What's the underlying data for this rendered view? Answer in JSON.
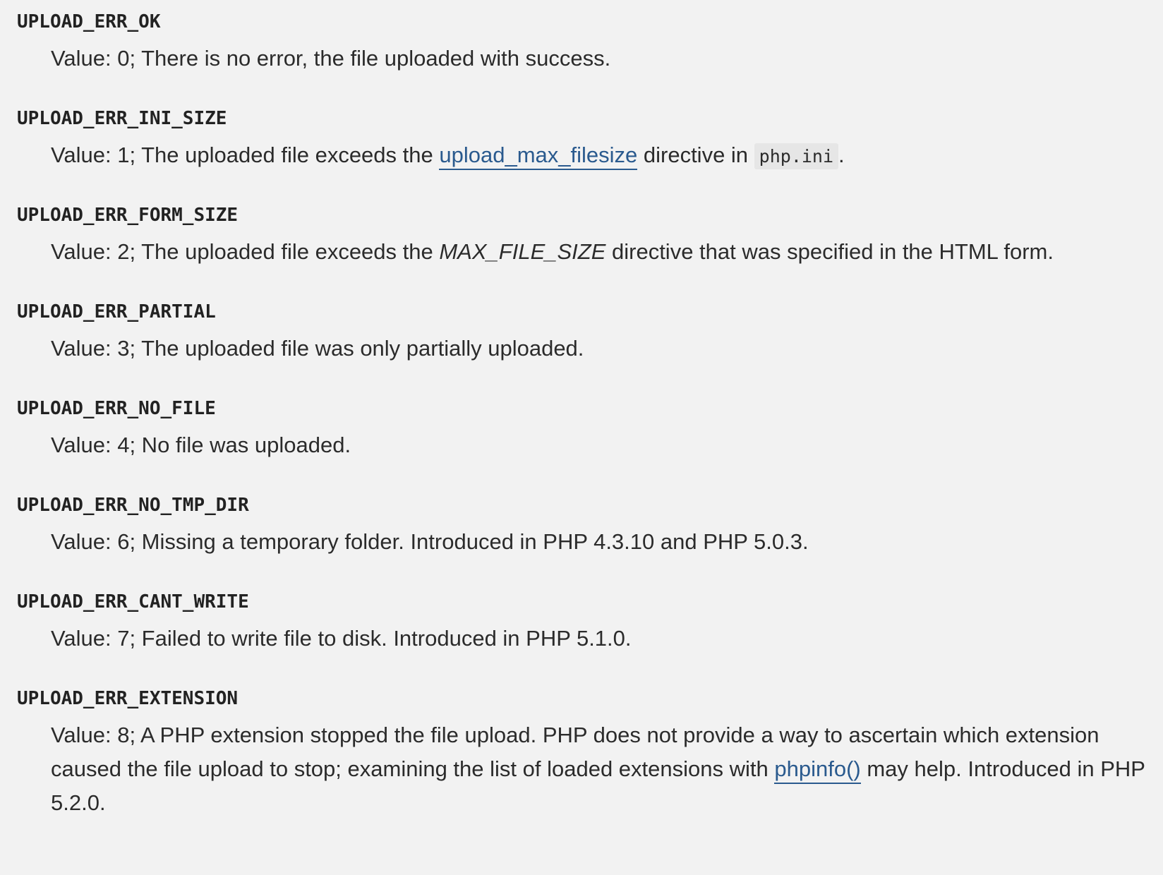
{
  "entries": [
    {
      "constant": "UPLOAD_ERR_OK",
      "description": "Value: 0; There is no error, the file uploaded with success."
    },
    {
      "constant": "UPLOAD_ERR_INI_SIZE",
      "desc_before": "Value: 1; The uploaded file exceeds the ",
      "link_text": "upload_max_filesize",
      "desc_middle": " directive in ",
      "code_text": "php.ini",
      "desc_after": "."
    },
    {
      "constant": "UPLOAD_ERR_FORM_SIZE",
      "desc_before": "Value: 2; The uploaded file exceeds the ",
      "emphasis_text": "MAX_FILE_SIZE",
      "desc_after": " directive that was specified in the HTML form."
    },
    {
      "constant": "UPLOAD_ERR_PARTIAL",
      "description": "Value: 3; The uploaded file was only partially uploaded."
    },
    {
      "constant": "UPLOAD_ERR_NO_FILE",
      "description": "Value: 4; No file was uploaded."
    },
    {
      "constant": "UPLOAD_ERR_NO_TMP_DIR",
      "description": "Value: 6; Missing a temporary folder. Introduced in PHP 4.3.10 and PHP 5.0.3."
    },
    {
      "constant": "UPLOAD_ERR_CANT_WRITE",
      "description": "Value: 7; Failed to write file to disk. Introduced in PHP 5.1.0."
    },
    {
      "constant": "UPLOAD_ERR_EXTENSION",
      "desc_before": "Value: 8; A PHP extension stopped the file upload. PHP does not provide a way to ascertain which extension caused the file upload to stop; examining the list of loaded extensions with ",
      "link_text": "phpinfo()",
      "desc_after": " may help. Introduced in PHP 5.2.0."
    }
  ]
}
